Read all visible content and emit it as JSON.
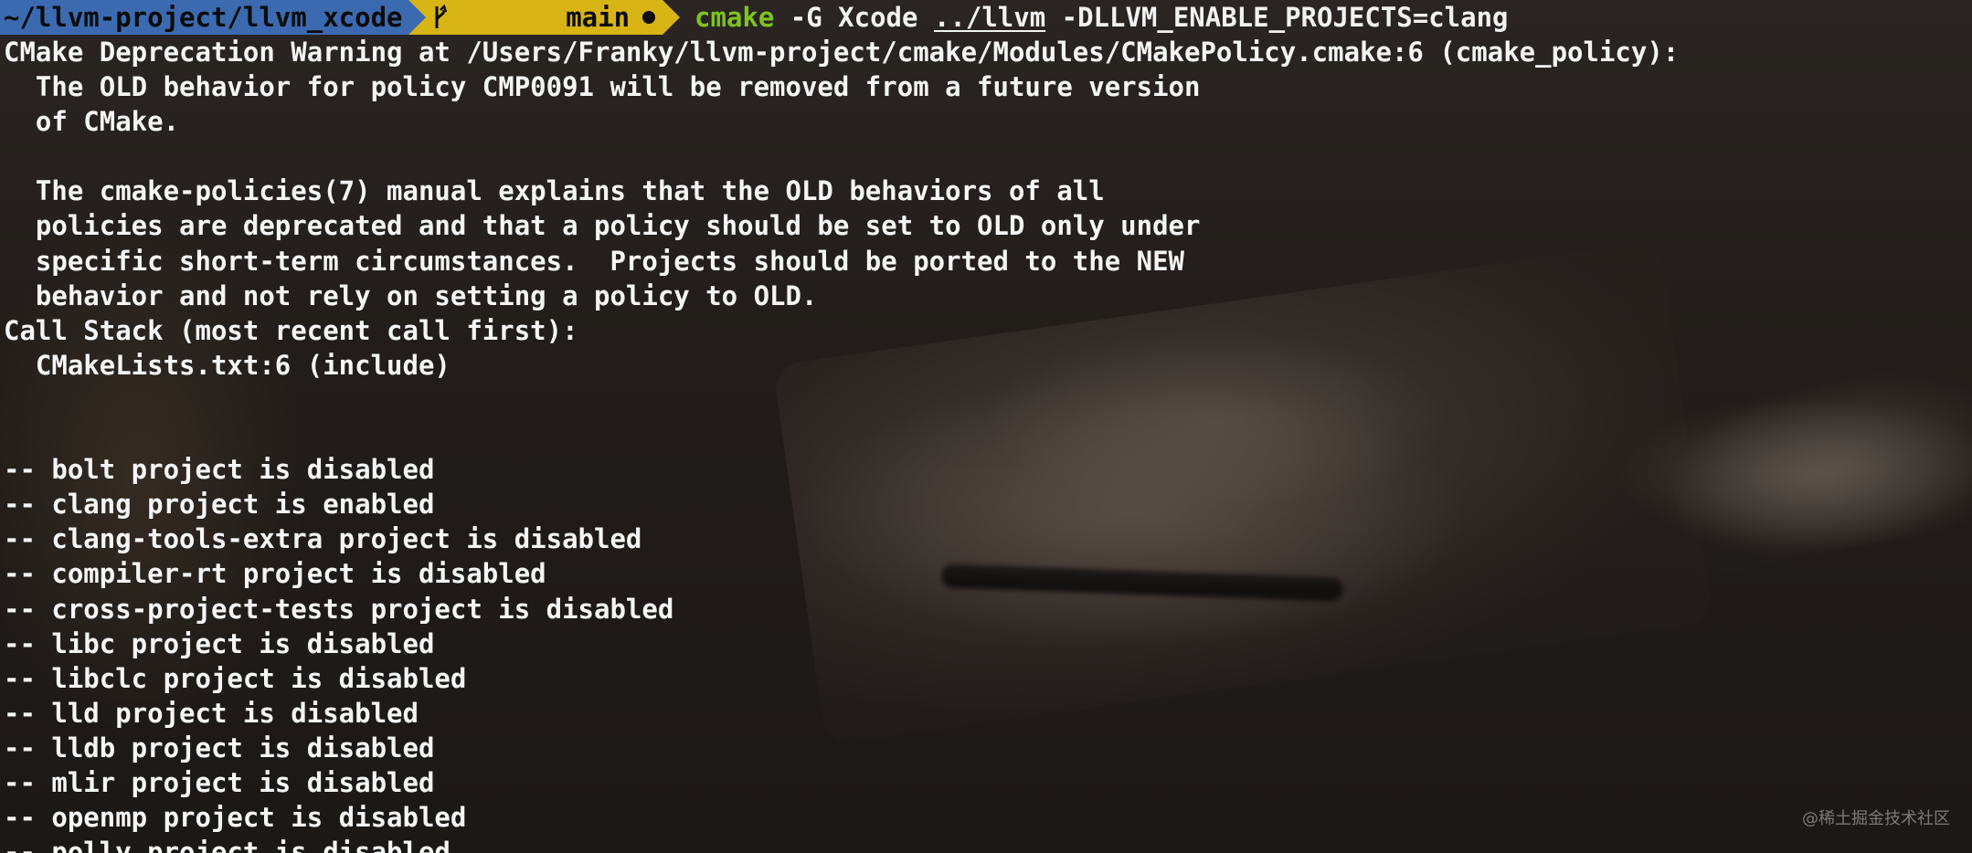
{
  "prompt": {
    "path": "~/llvm-project/llvm_xcode",
    "branch": "main",
    "branch_icon": "git-branch-icon",
    "dirty_indicator": "●",
    "colors": {
      "path_bg": "#3b6ab0",
      "branch_bg": "#d8b414",
      "command_bin": "#7fc21f"
    }
  },
  "command": {
    "bin": "cmake",
    "args_before": " -G Xcode ",
    "source_path": "../llvm",
    "args_after": " -DLLVM_ENABLE_PROJECTS=clang"
  },
  "output_lines": [
    "CMake Deprecation Warning at /Users/Franky/llvm-project/cmake/Modules/CMakePolicy.cmake:6 (cmake_policy):",
    "  The OLD behavior for policy CMP0091 will be removed from a future version",
    "  of CMake.",
    "",
    "  The cmake-policies(7) manual explains that the OLD behaviors of all",
    "  policies are deprecated and that a policy should be set to OLD only under",
    "  specific short-term circumstances.  Projects should be ported to the NEW",
    "  behavior and not rely on setting a policy to OLD.",
    "Call Stack (most recent call first):",
    "  CMakeLists.txt:6 (include)",
    "",
    "",
    "-- bolt project is disabled",
    "-- clang project is enabled",
    "-- clang-tools-extra project is disabled",
    "-- compiler-rt project is disabled",
    "-- cross-project-tests project is disabled",
    "-- libc project is disabled",
    "-- libclc project is disabled",
    "-- lld project is disabled",
    "-- lldb project is disabled",
    "-- mlir project is disabled",
    "-- openmp project is disabled",
    "-- polly project is disabled"
  ],
  "watermark": "@稀土掘金技术社区"
}
